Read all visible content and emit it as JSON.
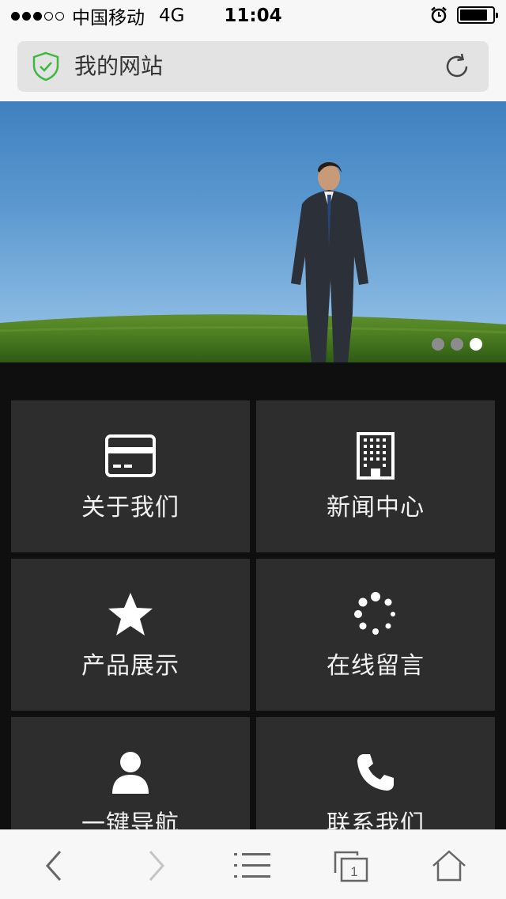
{
  "status_bar": {
    "carrier": "中国移动",
    "network": "4G",
    "time": "11:04",
    "signal_strength": 3,
    "signal_max": 5,
    "battery_level": 0.85,
    "icons": [
      "alarm-icon",
      "battery-icon"
    ]
  },
  "browser": {
    "site_title": "我的网站",
    "secure_icon": "shield-check-icon",
    "reload_icon": "reload-icon"
  },
  "banner": {
    "slide_count": 3,
    "active_slide": 3
  },
  "menu": {
    "items": [
      {
        "label": "关于我们",
        "icon": "card-icon"
      },
      {
        "label": "新闻中心",
        "icon": "building-icon"
      },
      {
        "label": "产品展示",
        "icon": "star-icon"
      },
      {
        "label": "在线留言",
        "icon": "spinner-icon"
      },
      {
        "label": "一键导航",
        "icon": "user-icon"
      },
      {
        "label": "联系我们",
        "icon": "phone-icon"
      }
    ]
  },
  "toolbar": {
    "back_icon": "chevron-left-icon",
    "forward_icon": "chevron-right-icon",
    "menu_icon": "list-icon",
    "tabs_icon": "tabs-icon",
    "tabs_count": "1",
    "home_icon": "home-icon"
  },
  "colors": {
    "background": "#0f0f0f",
    "tile": "#2d2d2d",
    "secure_green": "#3fb83f"
  }
}
